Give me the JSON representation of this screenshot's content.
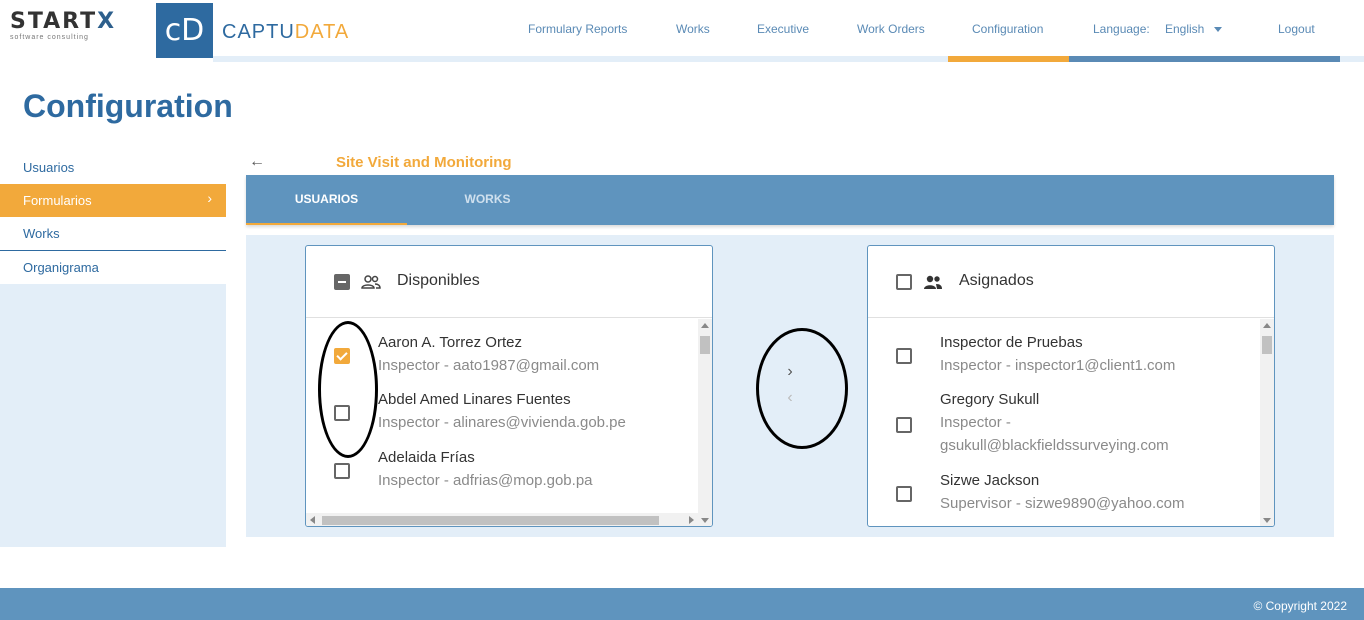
{
  "brand": {
    "startx_main": "START",
    "startx_accent": "X",
    "startx_tagline": "software consulting",
    "cd_logo": "cD",
    "captu_main": "CAPTU",
    "captu_accent": "DATA"
  },
  "nav": {
    "items": [
      "Formulary Reports",
      "Works",
      "Executive",
      "Work Orders",
      "Configuration"
    ],
    "language_label": "Language:",
    "language_value": "English",
    "logout": "Logout"
  },
  "page_title": "Configuration",
  "sidebar": {
    "items": [
      {
        "label": "Usuarios"
      },
      {
        "label": "Formularios"
      },
      {
        "label": "Works"
      },
      {
        "label": "Organigrama"
      }
    ],
    "active_chevron": "›"
  },
  "section": {
    "back_icon": "←",
    "title": "Site Visit and Monitoring"
  },
  "tabs": [
    "USUARIOS",
    "WORKS"
  ],
  "available": {
    "title": "Disponibles",
    "items": [
      {
        "name": "Aaron A. Torrez Ortez",
        "detail": "Inspector - aato1987@gmail.com"
      },
      {
        "name": "Abdel Amed Linares Fuentes",
        "detail": "Inspector - alinares@vivienda.gob.pe"
      },
      {
        "name": "Adelaida Frías",
        "detail": "Inspector - adfrias@mop.gob.pa"
      }
    ]
  },
  "assigned": {
    "title": "Asignados",
    "items": [
      {
        "name": "Inspector de Pruebas",
        "detail": "Inspector - inspector1@client1.com"
      },
      {
        "name": "Gregory Sukull",
        "detail": "Inspector -",
        "detail2": "gsukull@blackfieldssurveying.com"
      },
      {
        "name": "Sizwe Jackson",
        "detail": "Supervisor - sizwe9890@yahoo.com"
      }
    ]
  },
  "transfer": {
    "right": "›",
    "left": "‹"
  },
  "footer": {
    "copyright": "© Copyright 2022"
  },
  "colors": {
    "primary": "#2e6aa0",
    "accent": "#f2a93b",
    "tab_bar": "#5f94be",
    "light_bg": "#e3eef8"
  }
}
